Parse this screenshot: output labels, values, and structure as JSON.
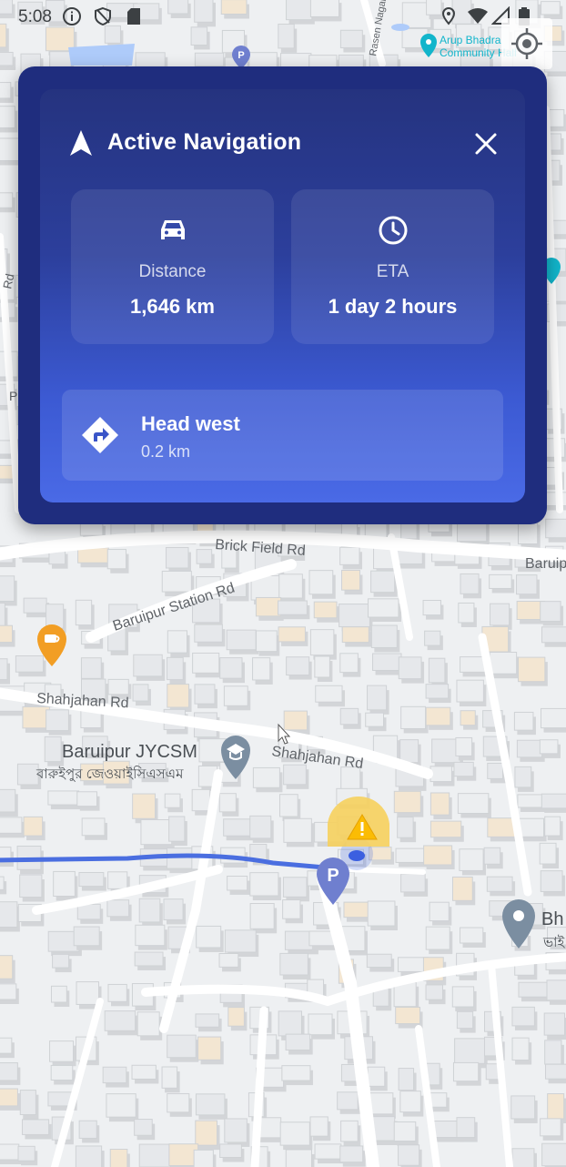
{
  "status_bar": {
    "time": "5:08",
    "icons": [
      "info-icon",
      "shield-icon",
      "sd-card-icon",
      "location-pin-icon",
      "wifi-icon",
      "signal-icon",
      "battery-icon"
    ]
  },
  "navigation_card": {
    "title": "Active Navigation",
    "distance": {
      "label": "Distance",
      "value": "1,646 km"
    },
    "eta": {
      "label": "ETA",
      "value": "1 day 2 hours"
    },
    "next_step": {
      "instruction": "Head west",
      "distance": "0.2 km"
    }
  },
  "map": {
    "labels": {
      "brick_field": "Brick Field Rd",
      "baruipur_station": "Baruipur Station Rd",
      "shahjahan_left": "Shahjahan Rd",
      "shahjahan_right": "Shahjahan Rd",
      "jycsm": "Baruipur JYCSM",
      "jycsm_bengali": "বারুইপুর জেওয়াইসিএসএম",
      "arup_line1": "Arup Bhadra",
      "arup_line2": "Community Hall",
      "baruipur_edge": "Baruip",
      "bh_edge": "Bh",
      "bh_bengali_edge": "ভাই",
      "rasen_nagar": "Rasen Nagar Rd",
      "rd_left": "Rd",
      "p_left": "P"
    },
    "parking_marker": "P",
    "colors": {
      "route": "#4a6ee0",
      "card": "#1f2d7e",
      "accent": "#4a6ae6"
    }
  }
}
